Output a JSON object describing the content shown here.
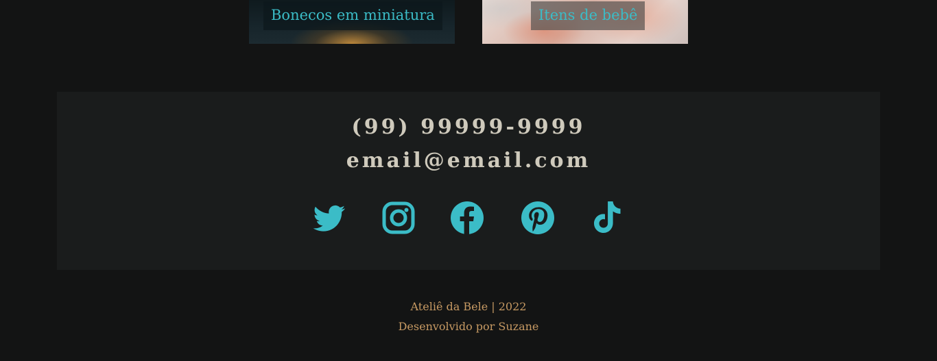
{
  "gallery": {
    "cards": [
      {
        "label": "Bonecos em miniatura"
      },
      {
        "label": "Itens de bebê"
      }
    ]
  },
  "contact": {
    "phone": "(99) 99999-9999",
    "email": "email@email.com"
  },
  "socials": [
    {
      "icon": "twitter-icon"
    },
    {
      "icon": "instagram-icon"
    },
    {
      "icon": "facebook-icon"
    },
    {
      "icon": "pinterest-icon"
    },
    {
      "icon": "tiktok-icon"
    }
  ],
  "footer": {
    "copyright": "Ateliê da Bele | 2022",
    "credit": "Desenvolvido por Suzane"
  },
  "colors": {
    "background": "#131414",
    "panel": "#1a1c1c",
    "accent": "#3bbcc7",
    "contact_text": "#cfcabc",
    "footer_text": "#c79a63"
  }
}
